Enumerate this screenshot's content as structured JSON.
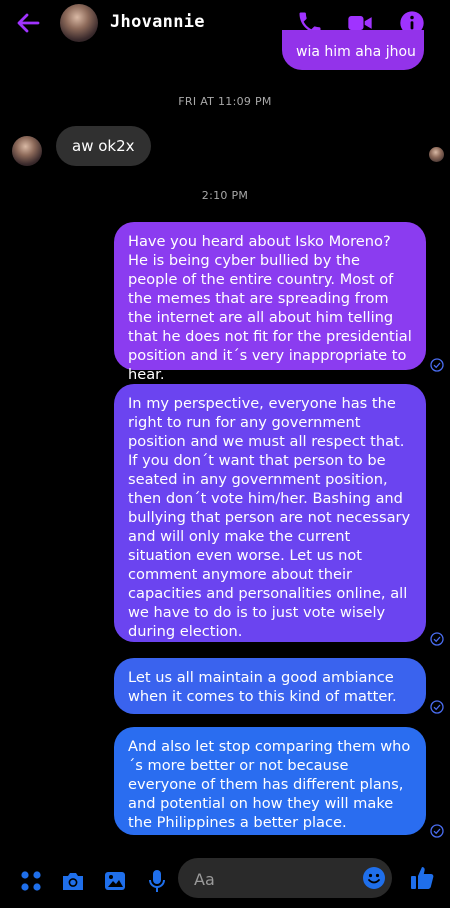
{
  "header": {
    "contact_name": "Jhovannie",
    "icons": [
      "back-arrow-icon",
      "phone-icon",
      "video-camera-icon",
      "info-icon"
    ],
    "accent": "#a033ff"
  },
  "conversation": {
    "partial_message": "wia him aha jhou",
    "timestamp_1": "FRI AT 11:09 PM",
    "incoming_message": "aw ok2x",
    "timestamp_2": "2:10 PM",
    "outgoing_messages": [
      {
        "text": "Have you heard about Isko Moreno? He is being cyber bullied  by the people of the entire country. Most of the memes that are spreading from the internet are all about him telling that he does not fit for the presidential position and it´s very inappropriate to hear.",
        "color": "#8b3cf0"
      },
      {
        "text": "In my perspective, everyone has the right to run for any government position and we must all respect that. If you don´t want that person to be seated in any government position, then don´t vote him/her. Bashing and bullying that person are not necessary and will only make the current situation even worse. Let us not comment anymore about their capacities and personalities online, all we have to do is to just vote wisely during election.",
        "color": "#6b44f0"
      },
      {
        "text": "Let us all maintain a good ambiance when it comes to this kind of matter.",
        "color": "#3a63ee"
      },
      {
        "text": "And also let stop comparing them who´s more better or not because everyone of them has different plans, and potential on how they will make the Philippines a better place.",
        "color": "#2a6df0"
      }
    ]
  },
  "composer": {
    "placeholder": "Aa",
    "icons": [
      "menu-dots-icon",
      "camera-icon",
      "gallery-icon",
      "microphone-icon",
      "emoji-icon",
      "thumbs-up-icon"
    ],
    "accent": "#1f6feb"
  }
}
